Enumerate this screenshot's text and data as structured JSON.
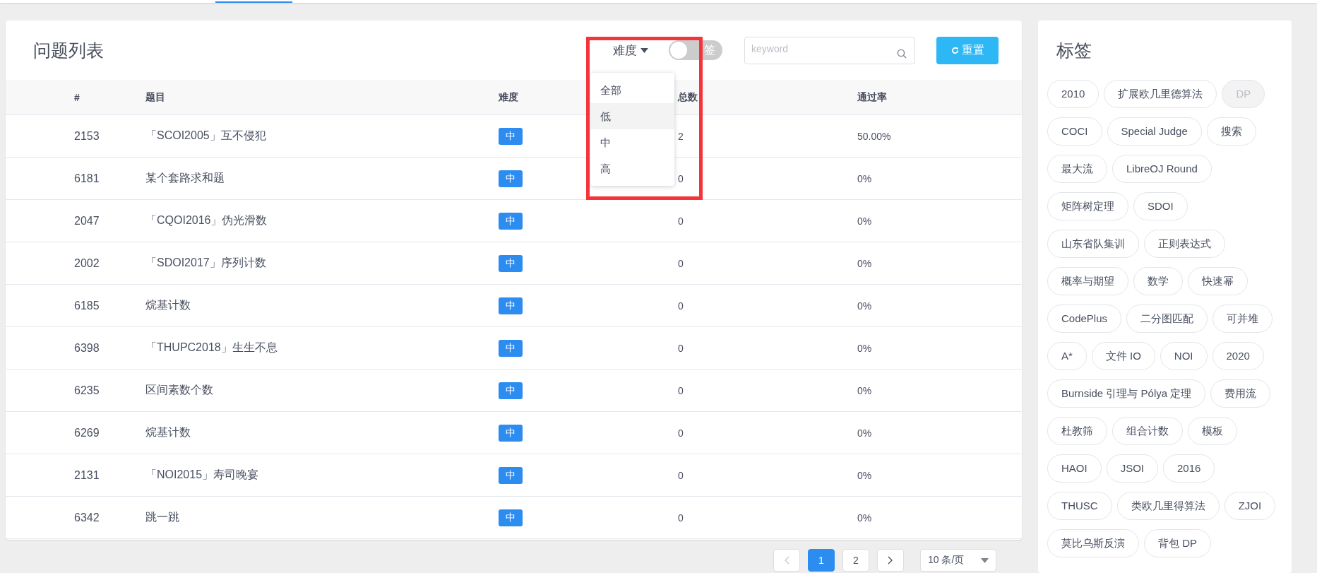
{
  "problem_list": {
    "title": "问题列表",
    "difficulty_filter": {
      "label": "难度",
      "expanded": true,
      "options": [
        {
          "label": "全部",
          "selected": false
        },
        {
          "label": "低",
          "selected": true
        },
        {
          "label": "中",
          "selected": false
        },
        {
          "label": "高",
          "selected": false
        }
      ]
    },
    "tag_toggle": {
      "label": "签",
      "on": false
    },
    "search": {
      "placeholder": "keyword"
    },
    "reset_button": {
      "label": "重置"
    },
    "table": {
      "columns": [
        "#",
        "题目",
        "难度",
        "总数",
        "通过率"
      ],
      "rows": [
        {
          "id": "2153",
          "title": "「SCOI2005」互不侵犯",
          "difficulty": "中",
          "total": "2",
          "pass_rate": "50.00%"
        },
        {
          "id": "6181",
          "title": "某个套路求和题",
          "difficulty": "中",
          "total": "0",
          "pass_rate": "0%"
        },
        {
          "id": "2047",
          "title": "「CQOI2016」伪光滑数",
          "difficulty": "中",
          "total": "0",
          "pass_rate": "0%"
        },
        {
          "id": "2002",
          "title": "「SDOI2017」序列计数",
          "difficulty": "中",
          "total": "0",
          "pass_rate": "0%"
        },
        {
          "id": "6185",
          "title": "烷基计数",
          "difficulty": "中",
          "total": "0",
          "pass_rate": "0%"
        },
        {
          "id": "6398",
          "title": "「THUPC2018」生生不息",
          "difficulty": "中",
          "total": "0",
          "pass_rate": "0%"
        },
        {
          "id": "6235",
          "title": "区间素数个数",
          "difficulty": "中",
          "total": "0",
          "pass_rate": "0%"
        },
        {
          "id": "6269",
          "title": "烷基计数",
          "difficulty": "中",
          "total": "0",
          "pass_rate": "0%"
        },
        {
          "id": "2131",
          "title": "「NOI2015」寿司晚宴",
          "difficulty": "中",
          "total": "0",
          "pass_rate": "0%"
        },
        {
          "id": "6342",
          "title": "跳一跳",
          "difficulty": "中",
          "total": "0",
          "pass_rate": "0%"
        }
      ]
    }
  },
  "pagination": {
    "pages": [
      {
        "label": "1",
        "selected": true
      },
      {
        "label": "2",
        "selected": false
      }
    ],
    "page_size": "10 条/页"
  },
  "tags": {
    "title": "标签",
    "items": [
      {
        "label": "2010",
        "disabled": false
      },
      {
        "label": "扩展欧几里德算法",
        "disabled": false
      },
      {
        "label": "DP",
        "disabled": true
      },
      {
        "label": "COCI",
        "disabled": false
      },
      {
        "label": "Special Judge",
        "disabled": false
      },
      {
        "label": "搜索",
        "disabled": false
      },
      {
        "label": "最大流",
        "disabled": false
      },
      {
        "label": "LibreOJ Round",
        "disabled": false
      },
      {
        "label": "矩阵树定理",
        "disabled": false
      },
      {
        "label": "SDOI",
        "disabled": false
      },
      {
        "label": "山东省队集训",
        "disabled": false
      },
      {
        "label": "正则表达式",
        "disabled": false
      },
      {
        "label": "概率与期望",
        "disabled": false
      },
      {
        "label": "数学",
        "disabled": false
      },
      {
        "label": "快速幂",
        "disabled": false
      },
      {
        "label": "CodePlus",
        "disabled": false
      },
      {
        "label": "二分图匹配",
        "disabled": false
      },
      {
        "label": "可并堆",
        "disabled": false
      },
      {
        "label": "A*",
        "disabled": false
      },
      {
        "label": "文件 IO",
        "disabled": false
      },
      {
        "label": "NOI",
        "disabled": false
      },
      {
        "label": "2020",
        "disabled": false
      },
      {
        "label": "Burnside 引理与 Pólya 定理",
        "disabled": false
      },
      {
        "label": "费用流",
        "disabled": false
      },
      {
        "label": "杜教筛",
        "disabled": false
      },
      {
        "label": "组合计数",
        "disabled": false
      },
      {
        "label": "模板",
        "disabled": false
      },
      {
        "label": "HAOI",
        "disabled": false
      },
      {
        "label": "JSOI",
        "disabled": false
      },
      {
        "label": "2016",
        "disabled": false
      },
      {
        "label": "THUSC",
        "disabled": false
      },
      {
        "label": "类欧几里得算法",
        "disabled": false
      },
      {
        "label": "ZJOI",
        "disabled": false
      },
      {
        "label": "莫比乌斯反演",
        "disabled": false
      },
      {
        "label": "背包 DP",
        "disabled": false
      }
    ]
  },
  "annotation": {
    "kind": "highlight-box",
    "color": "#f5333a"
  }
}
